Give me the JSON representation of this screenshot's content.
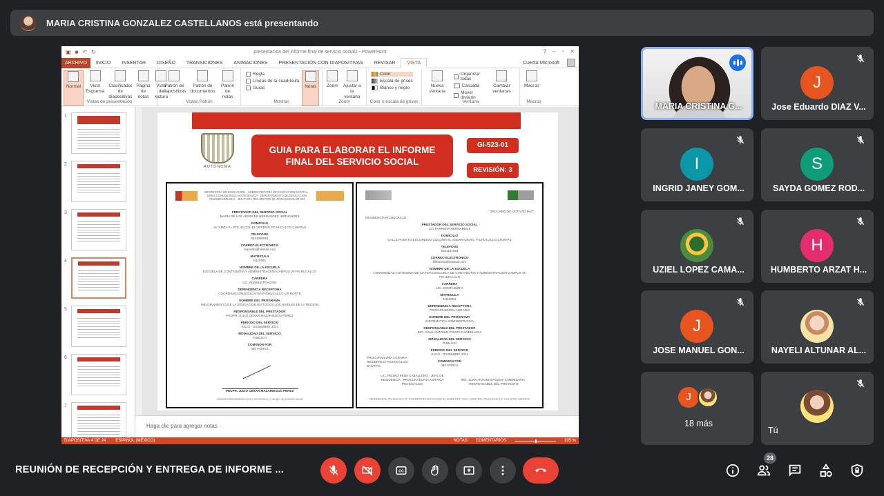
{
  "banner": {
    "presenter_text": "MARIA CRISTINA GONZALEZ CASTELLANOS está presentando"
  },
  "ppt": {
    "window_title": "presentacion del informe final de servicio social2 - PowerPoint",
    "tabs": [
      "ARCHIVO",
      "INICIO",
      "INSERTAR",
      "DISEÑO",
      "TRANSICIONES",
      "ANIMACIONES",
      "PRESENTACIÓN CON DIAPOSITIVAS",
      "REVISAR",
      "VISTA"
    ],
    "active_tab": "VISTA",
    "account": "Cuenta Microsoft",
    "ribbon": {
      "views": {
        "normal": "Normal",
        "esquema": "Vista Esquema",
        "clasificador": "Clasificador de diapositivas",
        "pagina_notas": "Página de notas",
        "lectura": "Vista de lectura",
        "label": "Vistas de presentación"
      },
      "patron": {
        "diapositivas": "Patrón de diapositivas",
        "documentos": "Patrón de documentos",
        "notas": "Patrón de notas",
        "label": "Vistas Patrón"
      },
      "mostrar": {
        "regla": "Regla",
        "cuadricula": "Líneas de la cuadrícula",
        "guias": "Guías",
        "notas": "Notas",
        "label": "Mostrar"
      },
      "zoom": {
        "zoom": "Zoom",
        "ajustar": "Ajustar a la ventana",
        "label": "Zoom"
      },
      "color": {
        "color": "Color",
        "grises": "Escala de grises",
        "bn": "Blanco y negro",
        "label": "Color o escala de grises"
      },
      "ventana": {
        "nueva": "Nueva ventana",
        "organizar": "Organizar todas",
        "cascada": "Cascada",
        "mover": "Mover división",
        "cambiar": "Cambiar ventanas",
        "label": "Ventana"
      },
      "macros": {
        "macros": "Macros",
        "label": "Macros"
      }
    },
    "thumb_numbers": [
      "1",
      "2",
      "3",
      "4",
      "5",
      "6",
      "7"
    ],
    "slide": {
      "title": "GUIA PARA ELABORAR EL INFORME FINAL DEL SERVICIO SOCIAL",
      "code": "GI-523-01",
      "revision": "REVISIÓN: 3",
      "logo_caption": "AUTONOMA"
    },
    "doc_left": {
      "header": "SECRETARIA DE EDUCACION · SUBSECRETARIA DE EDUCACION ESTATAL · DIRECCION DE EDUCACION BASICA · DEPARTAMENTO DE EDUCACION TELESECUNDARIA · JEFATURA DEL SECTOR 02, ZONA ESCOLAR 304",
      "lines": [
        [
          "PRESTADOR DEL SERVICIO SOCIAL",
          "MARIA DE LOS ANGELES HERNANDEZ HERNANDEZ"
        ],
        [
          "DOMICILIO",
          "AV 1 MZA 9 LOTE 40 COL EL VERDUN PICHUCALCO CHIAPAS"
        ],
        [
          "TELEFONO",
          "9321065551"
        ],
        [
          "CORREO ELECTRONICO",
          "mariahh@hotmail.com"
        ],
        [
          "MATRICULA",
          "N110081"
        ],
        [
          "NOMBRE DE LA ESCUELA",
          "ESCUELA DE CONTADURIA Y ADMINISTRACION CAMPUS VII PICHUCALCO"
        ],
        [
          "CARRERA",
          "LIC. ADMINISTRACION"
        ],
        [
          "DEPENDENCIA RECEPTORA",
          "COORDINACION EDUCATIVA PICHUCALCO VIII NORTE"
        ],
        [
          "NOMBRE DEL PROGRAMA",
          "MEJORAMIENTO DE LA EDUCACION EN TODOS LOS NIVELES DE LA REGION"
        ],
        [
          "RESPONSABLE DEL PRESTADOR",
          "PROFR. JULIO CESAR MAZARIEGOS PEREZ"
        ],
        [
          "PERIODO DEL SERVICIO",
          "JULIO - DICIEMBRE 2014"
        ],
        [
          "MODALIDAD DEL SERVICIO",
          "PUBLICO"
        ],
        [
          "COMISION POR",
          "480 HORAS"
        ]
      ],
      "signature": "PROFR. JULIO CESAR MAZARIEGOS PEREZ",
      "footer": "Unidad administrativa correo electronico y campo de servicio social"
    },
    "doc_right": {
      "year": "\"2014, AÑO DE OCTAVIO PAZ\"",
      "residence": "RESIDENCIA PICHUCALCO",
      "lines": [
        [
          "PRESTADOR DEL SERVICIO SOCIAL",
          "LILI FARRERA HERNANDEZ"
        ],
        [
          "DOMICILIO",
          "CALLE PUERTO ESCONDIDO COLONIA EL ASERRADERO, PICHUCALCO CHIAPAS"
        ],
        [
          "TELEFONO",
          "9321101964"
        ],
        [
          "CORREO ELECTRONICO",
          "lillifarrera@hotmail.com"
        ],
        [
          "NOMBRE DE LA ESCUELA",
          "UNIVERSIDAD AUTONOMA DE CHIAPAS ESCUELA DE CONTADURIA Y ADMINISTRACION CAMPUS VII PICHUCALCO"
        ],
        [
          "CARRERA",
          "LIC. CONTADURIA"
        ],
        [
          "MATRICULA",
          "N110004"
        ],
        [
          "DEPENDENCIA RECEPTORA",
          "PROCURADURIA AGRARIA"
        ],
        [
          "NOMBRE DEL PROGRAMA",
          "INFORMATICA ADMINISTRATIVA"
        ],
        [
          "RESPONSABLE DEL PRESTADOR",
          "ING. JUAN ANTONIO POZOS CANDELARIA"
        ],
        [
          "MODALIDAD DEL SERVICIO",
          "PUBLICO"
        ],
        [
          "PERIODO DEL SERVICIO",
          "JULIO - DICIEMBRE 2014"
        ],
        [
          "COMISION POR",
          "480 HORAS"
        ]
      ],
      "seal": "PROCURADURIA AGRARIA RESIDENCIA PICHUCALCO, CHIAPAS",
      "sign_left": "LIC. PEDRO PEÑA CABALLERO · JEFE DE RESIDENCIA · PROCURADURIA AGRARIA PICHUCALCO",
      "sign_right": "ING. JUAN ANTONIO POZOS CANDELARIA · RESPONSABLE DEL PROYECTO",
      "footer": "RESIDENCIA PICHUCALCO \"CARRETERA ESTACION EL SURESTE\" COL. CENTRO, PICHUCALCO, CHIAPAS, MEXICO"
    },
    "notes_placeholder": "Haga clic para agregar notas",
    "status": {
      "slide": "DIAPOSITIVA 4 DE 24",
      "lang": "ESPAÑOL (MÉXICO)",
      "notas": "NOTAS",
      "comentarios": "COMENTARIOS",
      "zoom": "105 %"
    }
  },
  "participants": [
    {
      "name": "MARIA CRISTINA G...",
      "type": "camera",
      "speaking": true
    },
    {
      "name": "Jose Eduardo DIAZ V...",
      "initial": "J",
      "color": "#e8541e"
    },
    {
      "name": "INGRID JANEY GOM...",
      "initial": "I",
      "color": "#0b97a8"
    },
    {
      "name": "SAYDA GOMEZ ROD...",
      "initial": "S",
      "color": "#0f9d79"
    },
    {
      "name": "UZIEL LOPEZ CAMA...",
      "type": "photo3"
    },
    {
      "name": "HUMBERTO ARZAT H...",
      "initial": "H",
      "color": "#e52c6f"
    },
    {
      "name": "JOSE MANUEL GON...",
      "initial": "J",
      "color": "#e8541e"
    },
    {
      "name": "NAYELI ALTUNAR AL...",
      "type": "photo"
    },
    {
      "name": "18 más",
      "type": "more",
      "initial": "J"
    },
    {
      "name": "Tú",
      "type": "you"
    }
  ],
  "bottom": {
    "meeting_title": "REUNIÓN DE RECEPCIÓN Y ENTREGA DE INFORME ...",
    "people_count": "28"
  },
  "colors": {
    "bg": "#202124",
    "tile": "#3c4043",
    "danger": "#ea4335",
    "accent": "#8ab4f8"
  }
}
